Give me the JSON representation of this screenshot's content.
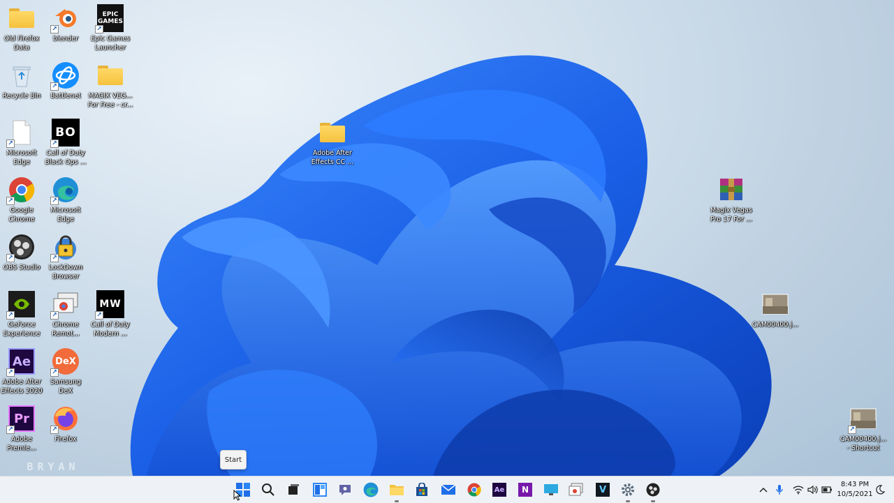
{
  "desktop": {
    "icons": [
      {
        "label": "Old Firefox\nData"
      },
      {
        "label": "blender"
      },
      {
        "label": "Epic Games\nLauncher",
        "logo_text": "EPIC\nGAMES"
      },
      {
        "label": "Recycle Bin"
      },
      {
        "label": "Battlenet"
      },
      {
        "label": "MAGIX VEG...\nFor Free - cr..."
      },
      {
        "label": "Microsoft\nEdge"
      },
      {
        "label": "Call of Duty\nBlack Ops ...",
        "logo_text": "BO"
      },
      {
        "label": "Google\nChrome"
      },
      {
        "label": "Microsoft\nEdge"
      },
      {
        "label": "OBS Studio"
      },
      {
        "label": "LockDown\nBrowser"
      },
      {
        "label": "GeForce\nExperience"
      },
      {
        "label": "Chrome\nRemot..."
      },
      {
        "label": "Call of Duty\nModern ...",
        "logo_text": "MW"
      },
      {
        "label": "Adobe After\nEffects 2020",
        "logo_text": "Ae"
      },
      {
        "label": "Samsung\nDeX",
        "logo_text": "DeX"
      },
      {
        "label": "Adobe\nPremie...",
        "logo_text": "Pr"
      },
      {
        "label": "Firefox"
      },
      {
        "label": "Adobe After\nEffects CC ..."
      },
      {
        "label": "Magix Vegas\nPro 17 For ..."
      },
      {
        "label": "CAM00400.j..."
      },
      {
        "label": "CAM00400.j...\n- Shortcut"
      }
    ]
  },
  "tooltip": {
    "text": "Start"
  },
  "watermark": {
    "text": "BRYAN\nC.A"
  },
  "taskbar": {
    "apps": [
      {
        "name": "windows-start-icon"
      },
      {
        "name": "search-icon"
      },
      {
        "name": "task-view-icon"
      },
      {
        "name": "widgets-icon"
      },
      {
        "name": "teams-chat-icon"
      },
      {
        "name": "edge-icon"
      },
      {
        "name": "file-explorer-icon"
      },
      {
        "name": "microsoft-store-icon"
      },
      {
        "name": "mail-icon"
      },
      {
        "name": "chrome-icon"
      },
      {
        "name": "after-effects-icon",
        "text": "Ae"
      },
      {
        "name": "onenote-icon",
        "text": "N"
      },
      {
        "name": "remote-desktop-icon"
      },
      {
        "name": "snipping-tool-icon"
      },
      {
        "name": "vegas-pro-icon",
        "text": "V"
      },
      {
        "name": "settings-icon"
      },
      {
        "name": "obs-icon"
      }
    ],
    "tray": {
      "time": "8:43 PM",
      "date": "10/5/2021"
    }
  },
  "colors": {
    "accent": "#1f6fe8",
    "wallpaper_bloom": "#1a66f0",
    "taskbar": "#eef2f6"
  }
}
